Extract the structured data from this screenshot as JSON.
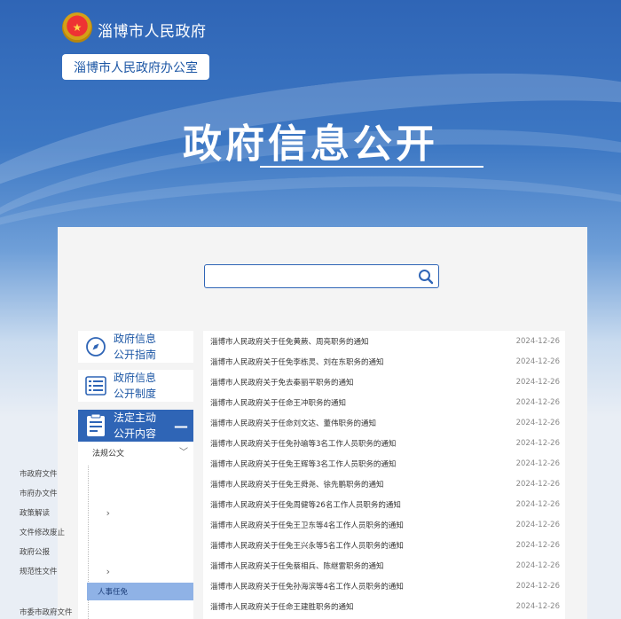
{
  "header": {
    "site_name": "淄博市人民政府",
    "office": "淄博市人民政府办公室",
    "title": "政府信息公开"
  },
  "search": {
    "placeholder": "",
    "icon": "search-icon"
  },
  "sidebar": {
    "cards": [
      {
        "line1": "政府信息",
        "line2": "公开指南",
        "icon": "compass-icon"
      },
      {
        "line1": "政府信息",
        "line2": "公开制度",
        "icon": "list-icon"
      }
    ],
    "active": {
      "line1": "法定主动",
      "line2": "公开内容",
      "icon": "document-icon",
      "toggle": "—"
    },
    "group": {
      "label": "法规公文",
      "arrow": "﹀"
    },
    "items": [
      {
        "label": "市政府文件",
        "arrow": ""
      },
      {
        "label": "市府办文件",
        "arrow": ""
      },
      {
        "label": "政策解读",
        "arrow": "›"
      },
      {
        "label": "文件修改废止",
        "arrow": ""
      },
      {
        "label": "政府公报",
        "arrow": ""
      },
      {
        "label": "规范性文件",
        "arrow": "›"
      },
      {
        "label": "人事任免",
        "arrow": ""
      },
      {
        "label": "市委市政府文件",
        "arrow": ""
      }
    ]
  },
  "list": [
    {
      "title": "淄博市人民政府关于任免黄蕨、周亮职务的通知",
      "date": "2024-12-26"
    },
    {
      "title": "淄博市人民政府关于任免李栋灵、刘在东职务的通知",
      "date": "2024-12-26"
    },
    {
      "title": "淄博市人民政府关于免去秦丽平职务的通知",
      "date": "2024-12-26"
    },
    {
      "title": "淄博市人民政府关于任命王冲职务的通知",
      "date": "2024-12-26"
    },
    {
      "title": "淄博市人民政府关于任命刘文达、董伟职务的通知",
      "date": "2024-12-26"
    },
    {
      "title": "淄博市人民政府关于任免孙瑜等3名工作人员职务的通知",
      "date": "2024-12-26"
    },
    {
      "title": "淄博市人民政府关于任免王辉等3名工作人员职务的通知",
      "date": "2024-12-26"
    },
    {
      "title": "淄博市人民政府关于任免王舜尧、徐先鹏职务的通知",
      "date": "2024-12-26"
    },
    {
      "title": "淄博市人民政府关于任免周健等26名工作人员职务的通知",
      "date": "2024-12-26"
    },
    {
      "title": "淄博市人民政府关于任免王卫东等4名工作人员职务的通知",
      "date": "2024-12-26"
    },
    {
      "title": "淄博市人民政府关于任免王兴永等5名工作人员职务的通知",
      "date": "2024-12-26"
    },
    {
      "title": "淄博市人民政府关于任免蔡相兵、陈继雷职务的通知",
      "date": "2024-12-26"
    },
    {
      "title": "淄博市人民政府关于任免孙海滨等4名工作人员职务的通知",
      "date": "2024-12-26"
    },
    {
      "title": "淄博市人民政府关于任命王建胜职务的通知",
      "date": "2024-12-26"
    }
  ],
  "colors": {
    "brand": "#2f65b6",
    "active_sub": "#8fb2e6"
  }
}
